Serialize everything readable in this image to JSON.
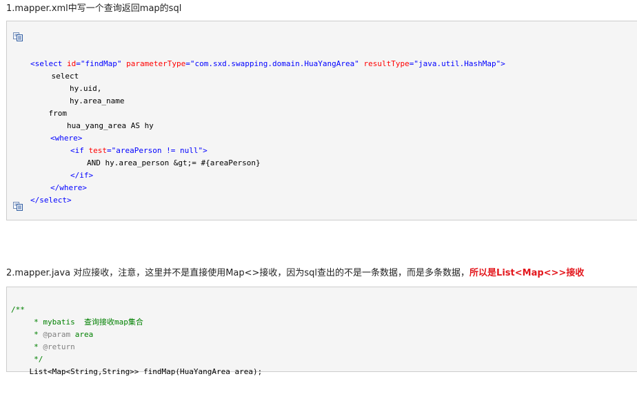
{
  "section1": {
    "heading": "1.mapper.xml中写一个查询返回map的sql"
  },
  "xml_code": {
    "select_open_lt": "<",
    "select_tag": "select",
    "id_attr": "id",
    "eq": "=",
    "id_val": "\"findMap\"",
    "param_attr": "parameterType",
    "param_val": "\"com.sxd.swapping.domain.HuaYangArea\"",
    "result_attr": "resultType",
    "result_val": "\"java.util.HashMap\"",
    "gt": ">",
    "line_select": "    select",
    "line_uid": "        hy.uid,",
    "line_area_name": "        hy.area_name",
    "line_from": "    from",
    "line_table": "        hua_yang_area AS hy",
    "where_open": "<where>",
    "if_tag": "<if",
    "test_attr": "test",
    "test_val": "\"areaPerson != null\"",
    "line_and": "        AND hy.area_person &gt;= #{areaPerson}",
    "if_close": "</if>",
    "where_close": "</where>",
    "select_close": "</select>"
  },
  "section2": {
    "heading_normal": "2.mapper.java 对应接收，注意，这里并不是直接使用Map<>接收，因为sql查出的不是一条数据，而是多条数据，",
    "heading_emphasis": "所以是List<Map<>>接收"
  },
  "java_code": {
    "line1": "/**",
    "line2": "     * mybatis  查询接收map集合",
    "line3_star": "     * ",
    "line3_tag": "@param",
    "line3_name": " area",
    "line4_star": "     * ",
    "line4_tag": "@return",
    "line5": "     */",
    "line6": "    List<Map<String,String>> findMap(HuaYangArea area);"
  },
  "icons": {
    "copy_top": "copy-code-icon",
    "copy_bottom": "copy-code-icon"
  }
}
